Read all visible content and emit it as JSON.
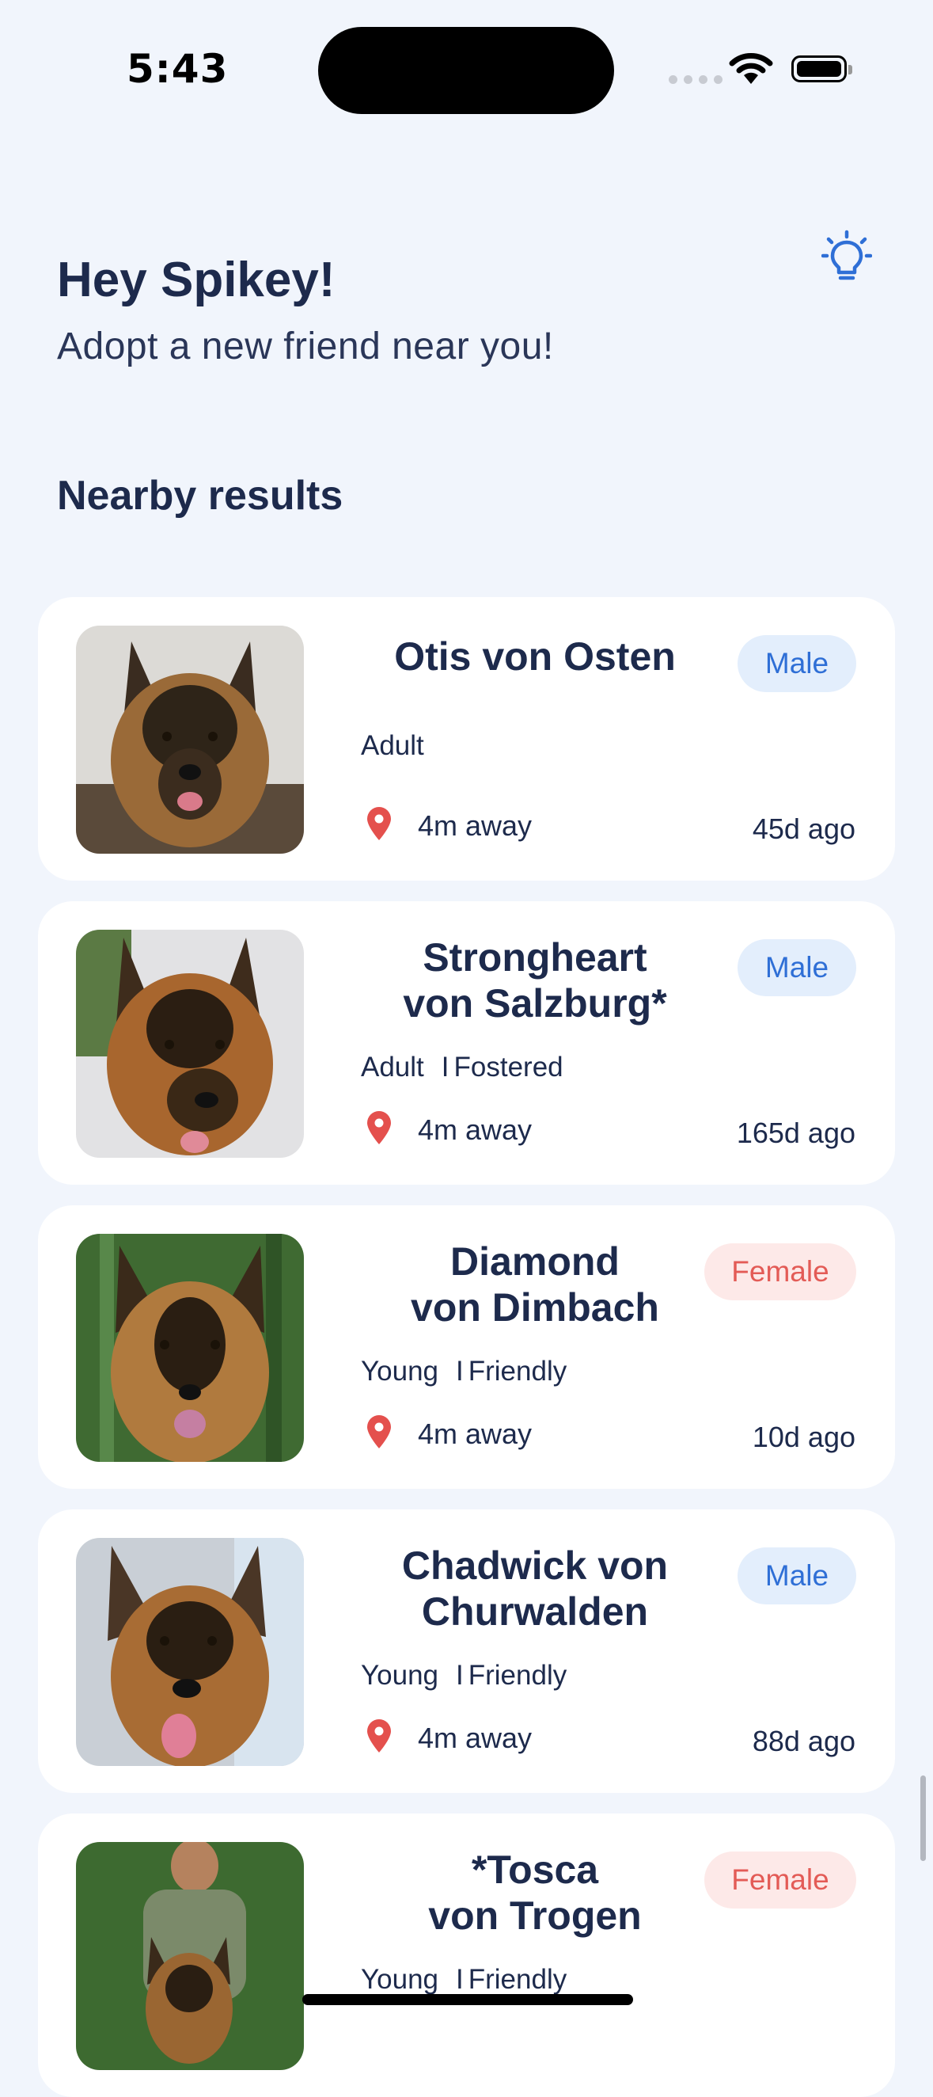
{
  "status_bar": {
    "time": "5:43"
  },
  "header": {
    "greeting": "Hey Spikey!",
    "subtitle": "Adopt a new friend near you!",
    "tip_icon": "lightbulb-icon"
  },
  "section_title": "Nearby results",
  "colors": {
    "male_badge_bg": "#e3eefc",
    "male_badge_text": "#2f6fd6",
    "female_badge_bg": "#fde9e8",
    "female_badge_text": "#e35b56",
    "pin": "#e4504d",
    "heading": "#1d2a4c",
    "background": "#f1f5fc"
  },
  "results": [
    {
      "name_line1": "Otis von Osten",
      "name_line2": "",
      "gender": "Male",
      "age": "Adult",
      "tag": "",
      "distance": "4m away",
      "posted": "45d ago"
    },
    {
      "name_line1": "Strongheart",
      "name_line2": "von Salzburg*",
      "gender": "Male",
      "age": "Adult",
      "tag": "Fostered",
      "distance": "4m away",
      "posted": "165d ago"
    },
    {
      "name_line1": "Diamond",
      "name_line2": "von Dimbach",
      "gender": "Female",
      "age": "Young",
      "tag": "Friendly",
      "distance": "4m away",
      "posted": "10d ago"
    },
    {
      "name_line1": "Chadwick von",
      "name_line2": "Churwalden",
      "gender": "Male",
      "age": "Young",
      "tag": "Friendly",
      "distance": "4m away",
      "posted": "88d ago"
    },
    {
      "name_line1": "*Tosca",
      "name_line2": "von Trogen",
      "gender": "Female",
      "age": "Young",
      "tag": "Friendly",
      "distance": "",
      "posted": ""
    }
  ]
}
